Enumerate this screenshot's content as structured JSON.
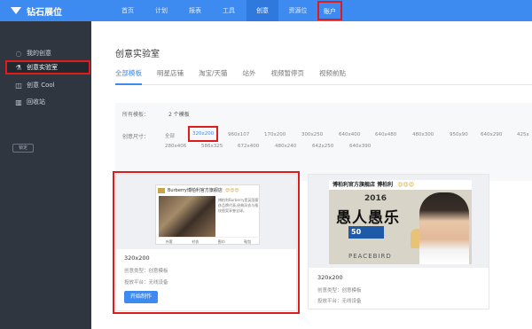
{
  "app": {
    "logo": "钻石展位"
  },
  "topnav": [
    "首页",
    "计划",
    "报表",
    "工具",
    "创意",
    "资源位",
    "账户"
  ],
  "sidebar": {
    "items": [
      {
        "label": "我的创意",
        "icon": "lightbulb-icon"
      },
      {
        "label": "创意实验室",
        "icon": "flask-icon"
      },
      {
        "label": "创意 Cool",
        "icon": "cool-icon"
      },
      {
        "label": "回收站",
        "icon": "trash-icon"
      }
    ],
    "button": "锁定"
  },
  "main": {
    "title": "创意实验室",
    "tabs": [
      "全部模板",
      "明星店铺",
      "淘宝/天猫",
      "站外",
      "视频暂停页",
      "视频前贴"
    ],
    "filter": {
      "all_label": "所有模板：",
      "count": "2 个模板",
      "size_label": "创意尺寸：",
      "sizes_row1": [
        "全部",
        "320x200",
        "960x107",
        "170x200",
        "300x250",
        "640x400",
        "640x480",
        "480x300",
        "950x90",
        "640x290",
        "425x"
      ],
      "sizes_row2": [
        "280x406",
        "586x325",
        "672x400",
        "480x240",
        "642x250",
        "640x390"
      ]
    },
    "cards": [
      {
        "title": "320x200",
        "type": "创意类型：创意模板",
        "platform": "投放平台：无线设备",
        "button": "开始制作",
        "banner": {
          "heading": "Burberry博柏利官方旗舰店",
          "emoji": "😍😍😍",
          "text": "博柏利Burberry是英国奢侈品牌代表,经典风衣与格纹图案享誉全球。",
          "footer": [
            "外套",
            "衬衣",
            "围巾",
            "鞋包"
          ]
        }
      },
      {
        "title": "320x200",
        "type": "创意类型：创意模板",
        "platform": "投放平台：无线设备",
        "banner": {
          "heading": "博柏利官方旗舰店 博柏利",
          "emoji": "😍😍😍",
          "year": "2016",
          "big": "愚人愚乐",
          "tag": "50",
          "brand": "PEACEBIRD"
        }
      }
    ]
  },
  "colors": {
    "brand": "#3d8bf0",
    "sidebar": "#2f3640",
    "highlight": "#e01b1b"
  }
}
